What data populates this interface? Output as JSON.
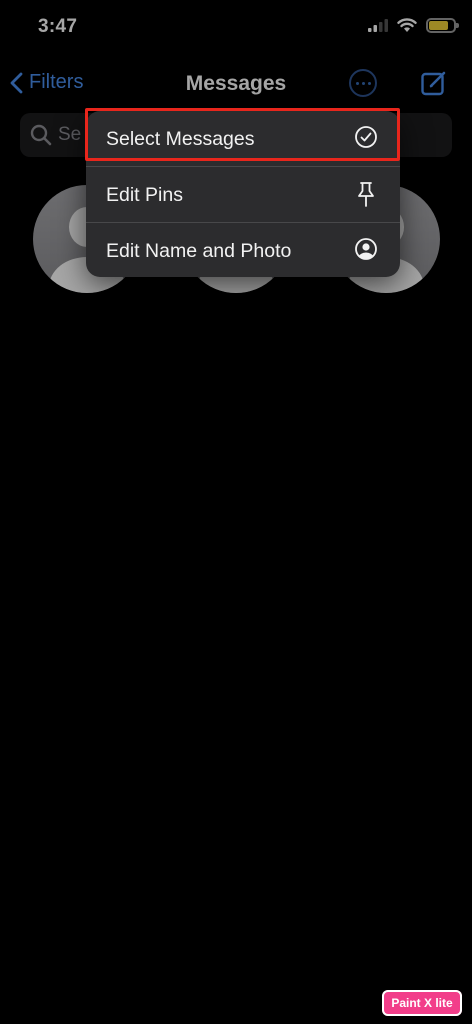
{
  "status_bar": {
    "time": "3:47",
    "battery_color": "#f3d33a",
    "battery_level": 0.85
  },
  "navbar": {
    "back_label": "Filters",
    "title": "Messages",
    "accent_color": "#4a8ff0"
  },
  "search": {
    "placeholder_visible": "Se"
  },
  "pinned_contacts": [
    {
      "icon": "person-avatar-icon"
    },
    {
      "icon": "person-avatar-icon"
    },
    {
      "icon": "person-avatar-icon"
    }
  ],
  "menu": {
    "items": [
      {
        "label": "Select Messages",
        "icon": "checkmark-circle-icon"
      },
      {
        "label": "Edit Pins",
        "icon": "pin-icon"
      },
      {
        "label": "Edit Name and Photo",
        "icon": "person-circle-icon"
      }
    ],
    "highlight_color": "#e8261c"
  },
  "watermark": {
    "text": "Paint X lite"
  }
}
